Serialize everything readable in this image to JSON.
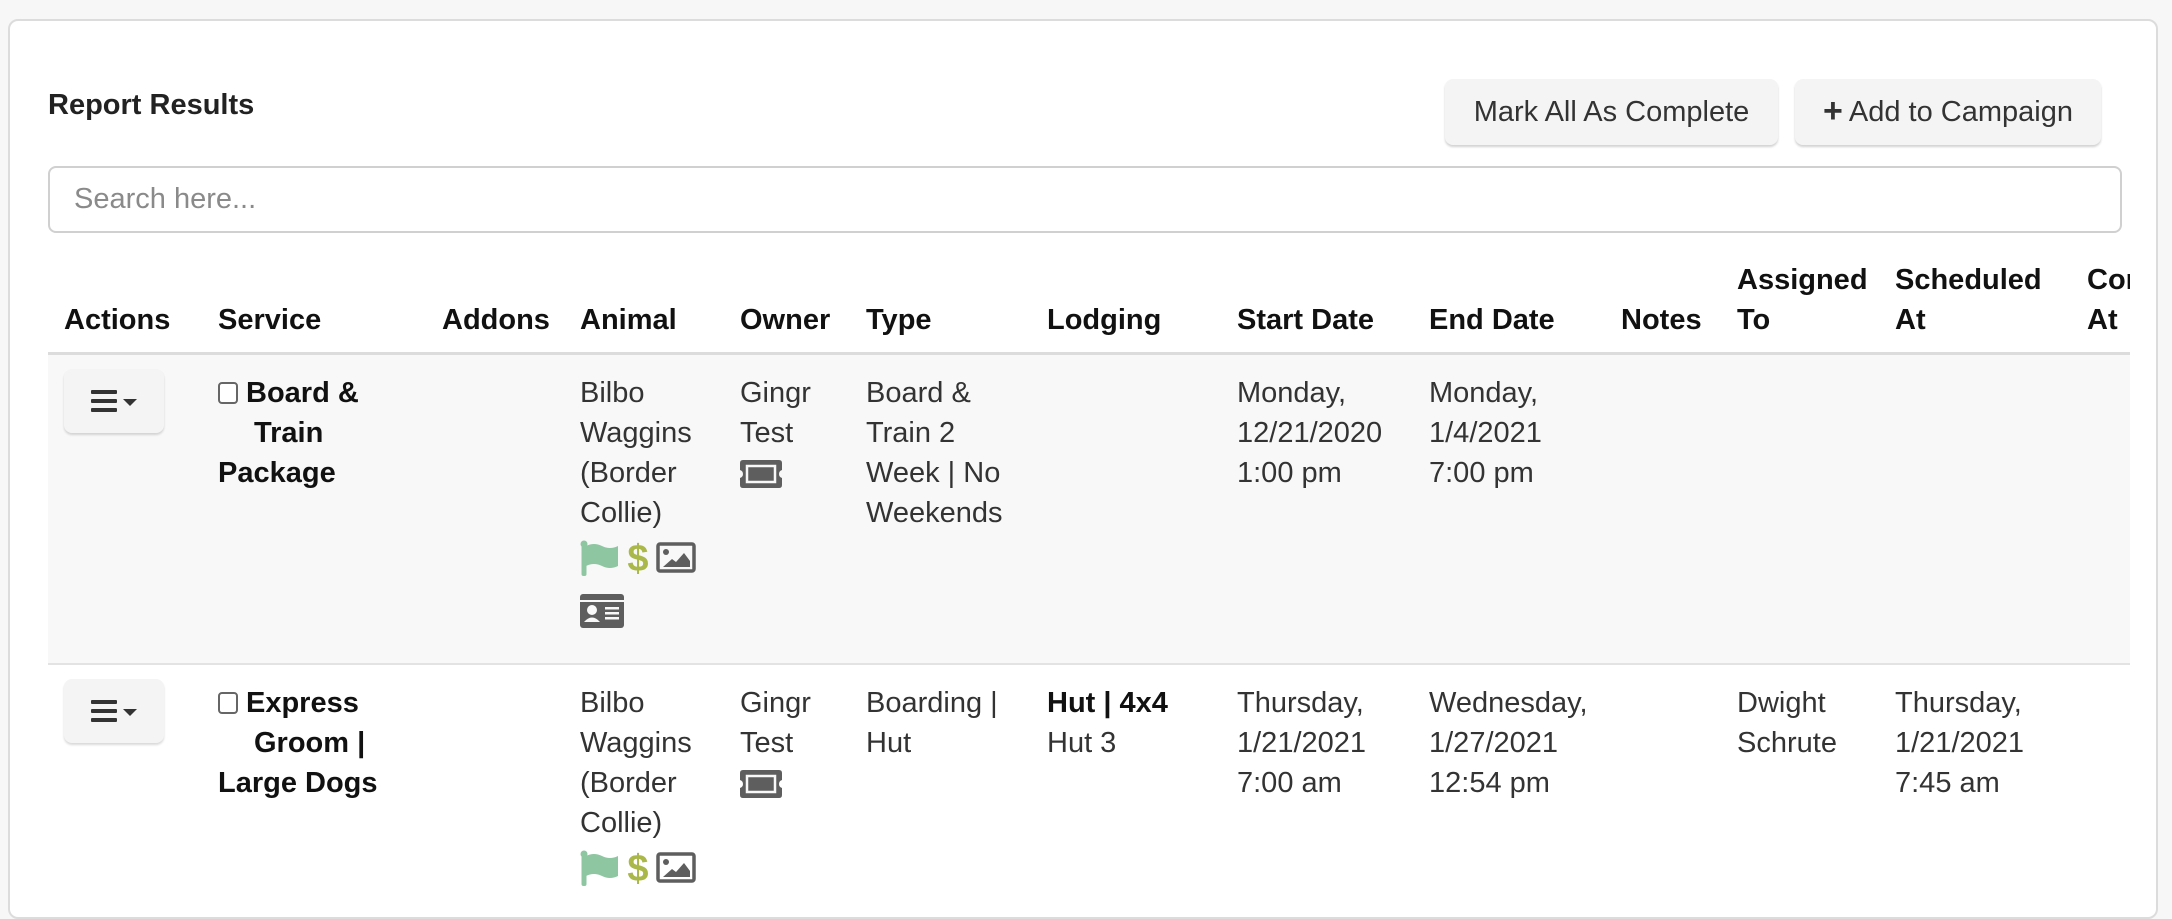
{
  "page": {
    "title": "Report Results",
    "buttons": {
      "mark_all_complete": "Mark All As Complete",
      "add_to_campaign": "Add to Campaign",
      "add_to_campaign_icon": "plus-icon"
    },
    "search": {
      "placeholder": "Search here...",
      "value": ""
    }
  },
  "colors": {
    "flag": "#8fc6a2",
    "dollar": "#aab84a",
    "icon_gray": "#5e5e5e",
    "row_bg": "#f8f8f8"
  },
  "table": {
    "columns": [
      "Actions",
      "Service",
      "Addons",
      "Animal",
      "Owner",
      "Type",
      "Lodging",
      "Start Date",
      "End Date",
      "Notes",
      "Assigned To",
      "Scheduled At",
      "Com At"
    ],
    "rows": [
      {
        "actions_icon": "hamburger-dropdown-icon",
        "service_lines": [
          "Board &",
          "Train",
          "Package"
        ],
        "addons": "",
        "animal_lines": [
          "Bilbo",
          "Waggins",
          "(Border",
          "Collie)"
        ],
        "animal_icons": [
          "flag-icon",
          "dollar-icon",
          "image-icon",
          "id-card-icon"
        ],
        "owner_lines": [
          "Gingr",
          "Test"
        ],
        "owner_icon": "ticket-icon",
        "type_lines": [
          "Board &",
          "Train 2",
          "Week | No",
          "Weekends"
        ],
        "lodging_bold": "",
        "lodging": "",
        "start_lines": [
          "Monday,",
          "12/21/2020",
          "1:00 pm"
        ],
        "end_lines": [
          "Monday,",
          "1/4/2021",
          "7:00 pm"
        ],
        "notes": "",
        "assigned_lines": [],
        "scheduled_lines": [],
        "completed": ""
      },
      {
        "actions_icon": "hamburger-dropdown-icon",
        "service_lines": [
          "Express",
          "Groom |",
          "Large Dogs"
        ],
        "addons": "",
        "animal_lines": [
          "Bilbo",
          "Waggins",
          "(Border",
          "Collie)"
        ],
        "animal_icons": [
          "flag-icon",
          "dollar-icon",
          "image-icon"
        ],
        "owner_lines": [
          "Gingr",
          "Test"
        ],
        "owner_icon": "ticket-icon",
        "type_lines": [
          "Boarding |",
          "Hut"
        ],
        "lodging_bold": "Hut | 4x4",
        "lodging": "Hut 3",
        "start_lines": [
          "Thursday,",
          "1/21/2021",
          "7:00 am"
        ],
        "end_lines": [
          "Wednesday,",
          "1/27/2021",
          "12:54 pm"
        ],
        "notes": "",
        "assigned_lines": [
          "Dwight",
          "Schrute"
        ],
        "scheduled_lines": [
          "Thursday,",
          "1/21/2021",
          "7:45 am"
        ],
        "completed": ""
      }
    ]
  }
}
